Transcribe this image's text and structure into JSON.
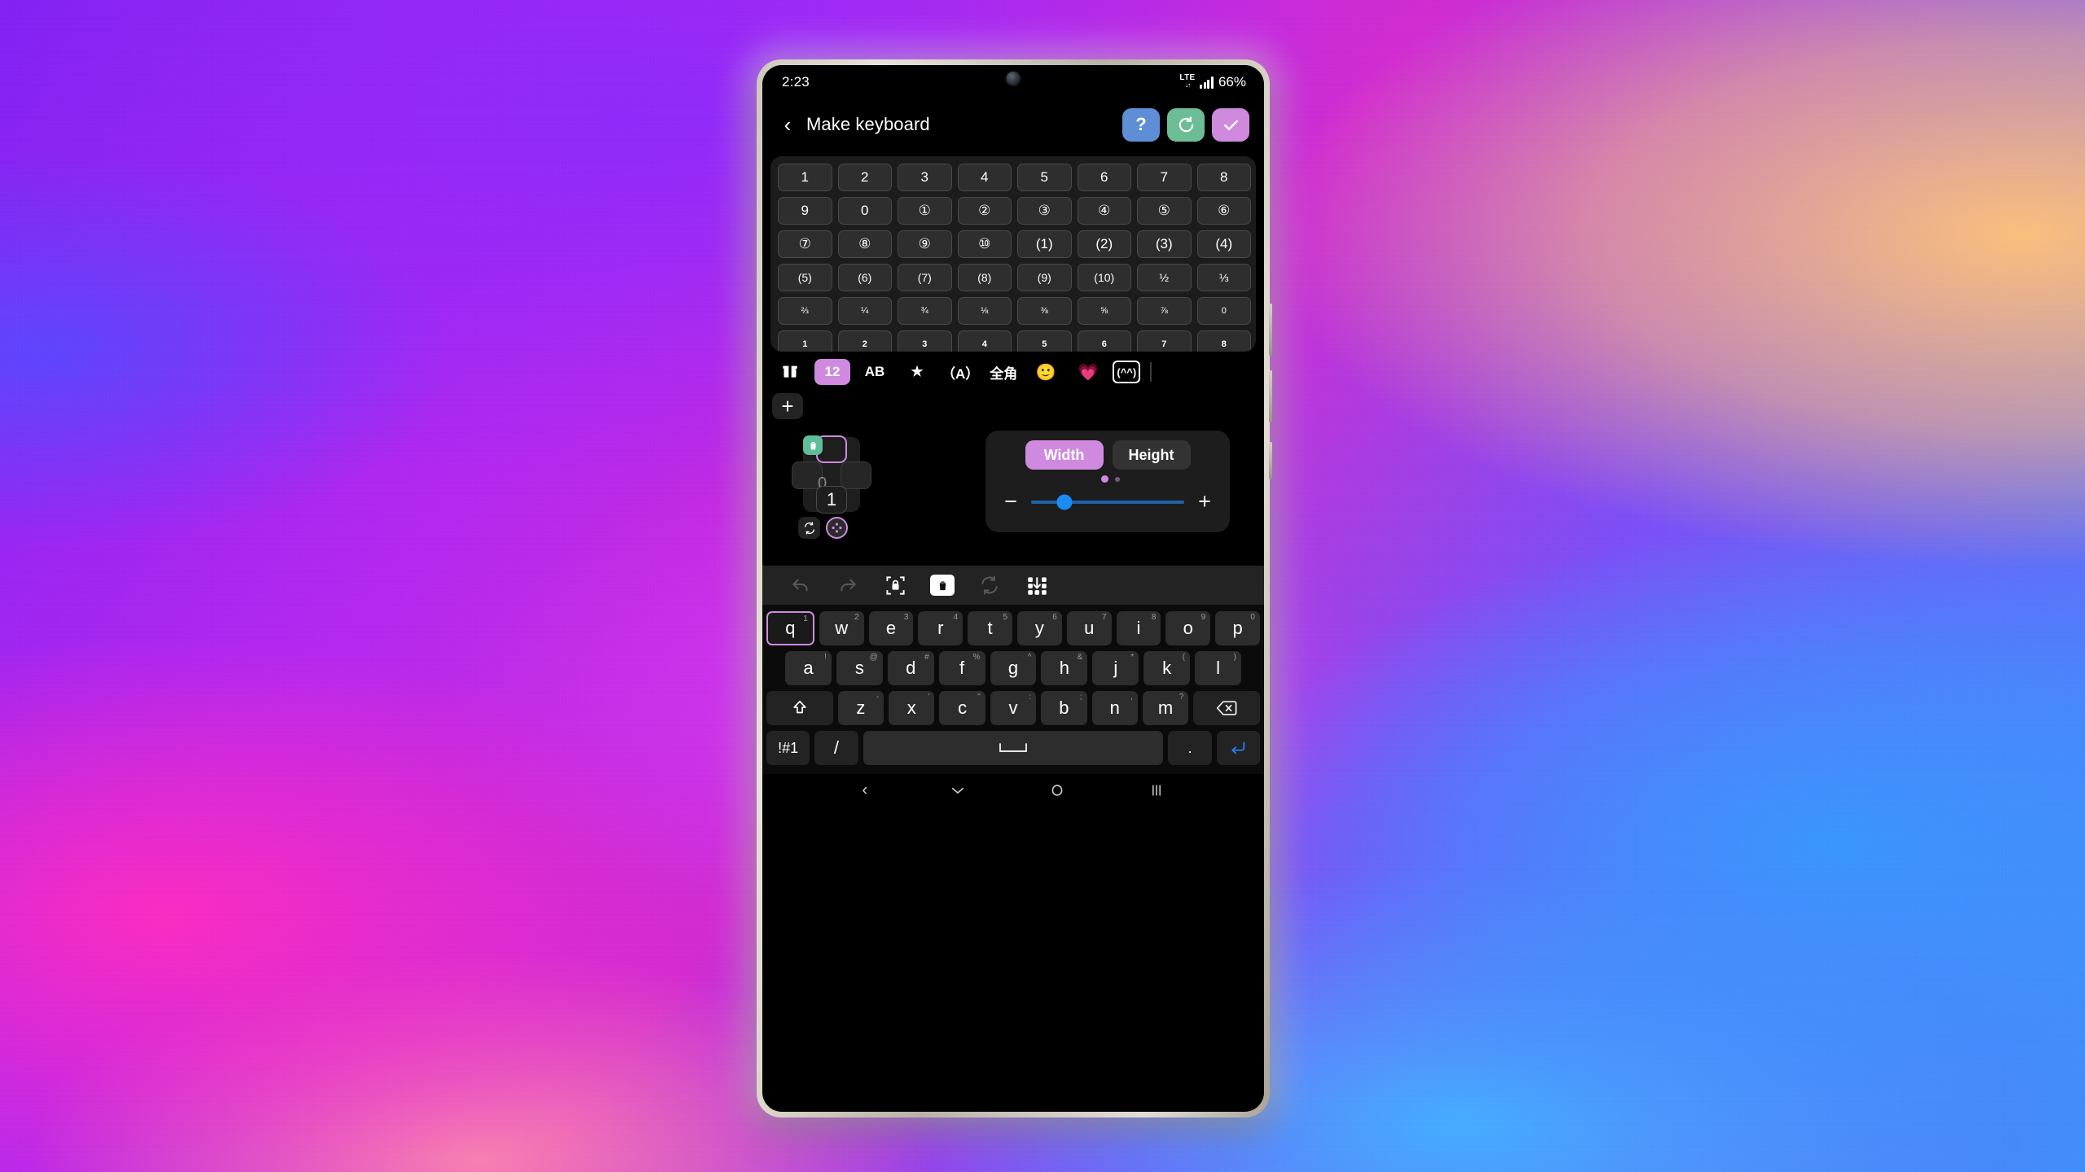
{
  "status_bar": {
    "time": "2:23",
    "network_type": "LTE",
    "network_arrows": "↓↑",
    "battery": "66%"
  },
  "app_bar": {
    "back_icon": "chevron-left-icon",
    "title": "Make keyboard",
    "actions": [
      {
        "name": "help-button",
        "label": "?",
        "color": "#5e8ed6"
      },
      {
        "name": "reset-button",
        "label": "↺",
        "color": "#6cbd96"
      },
      {
        "name": "confirm-button",
        "label": "✓",
        "color": "#cf8ae0"
      }
    ]
  },
  "palette": {
    "rows": [
      {
        "style": "normal",
        "keys": [
          "1",
          "2",
          "3",
          "4",
          "5",
          "6",
          "7",
          "8"
        ]
      },
      {
        "style": "normal",
        "keys": [
          "9",
          "0",
          "①",
          "②",
          "③",
          "④",
          "⑤",
          "⑥"
        ]
      },
      {
        "style": "normal",
        "keys": [
          "⑦",
          "⑧",
          "⑨",
          "⑩",
          "(1)",
          "(2)",
          "(3)",
          "(4)"
        ]
      },
      {
        "style": "small",
        "keys": [
          "(5)",
          "(6)",
          "(7)",
          "(8)",
          "(9)",
          "(10)",
          "½",
          "⅓"
        ]
      },
      {
        "style": "tiny",
        "keys": [
          "⅔",
          "¼",
          "¾",
          "⅛",
          "⅜",
          "⅝",
          "⅞",
          "0"
        ]
      },
      {
        "style": "sup",
        "keys": [
          "1",
          "2",
          "3",
          "4",
          "5",
          "6",
          "7",
          "8"
        ]
      }
    ]
  },
  "categories": [
    {
      "name": "category-symbols",
      "label": "⬚",
      "active": false,
      "kind": "glyph"
    },
    {
      "name": "category-numbers",
      "label": "12",
      "active": true,
      "kind": "text"
    },
    {
      "name": "category-ab",
      "label": "AB",
      "active": false,
      "kind": "text"
    },
    {
      "name": "category-star",
      "label": "★",
      "active": false,
      "kind": "glyph"
    },
    {
      "name": "category-paren-a",
      "label": "（A）",
      "active": false,
      "kind": "text"
    },
    {
      "name": "category-fullwidth",
      "label": "全角",
      "active": false,
      "kind": "text"
    },
    {
      "name": "category-emoji",
      "label": "🙂",
      "active": false,
      "kind": "emoji"
    },
    {
      "name": "category-heart",
      "label": "💗",
      "active": false,
      "kind": "emoji"
    },
    {
      "name": "category-kaomoji",
      "label": "(^^)",
      "active": false,
      "kind": "box"
    }
  ],
  "editor": {
    "add_key_label": "+",
    "flick": {
      "delete_icon": "trash-icon",
      "rotate_icon": "rotate-icon",
      "move_icon": "move-handle-icon",
      "center_label": "1",
      "ghost_label": "0",
      "selected_direction": "up"
    },
    "size_panel": {
      "tabs": [
        {
          "name": "width-tab",
          "label": "Width",
          "active": true
        },
        {
          "name": "height-tab",
          "label": "Height",
          "active": false
        }
      ],
      "page_dots": [
        true,
        false
      ],
      "minus_label": "−",
      "plus_label": "+",
      "slider_percent": 22
    }
  },
  "edit_toolbar": [
    {
      "name": "undo-button",
      "icon": "undo-icon",
      "enabled": false
    },
    {
      "name": "redo-button",
      "icon": "redo-icon",
      "enabled": false
    },
    {
      "name": "lock-button",
      "icon": "lock-frame-icon",
      "enabled": true
    },
    {
      "name": "delete-button",
      "icon": "trash-icon",
      "enabled": true
    },
    {
      "name": "refresh-button",
      "icon": "refresh-icon",
      "enabled": false
    },
    {
      "name": "arrange-button",
      "icon": "grid-arrange-icon",
      "enabled": true
    }
  ],
  "keyboard": {
    "row1": [
      {
        "key": "q",
        "sup": "1",
        "selected": true
      },
      {
        "key": "w",
        "sup": "2",
        "selected": false
      },
      {
        "key": "e",
        "sup": "3",
        "selected": false
      },
      {
        "key": "r",
        "sup": "4",
        "selected": false
      },
      {
        "key": "t",
        "sup": "5",
        "selected": false
      },
      {
        "key": "y",
        "sup": "6",
        "selected": false
      },
      {
        "key": "u",
        "sup": "7",
        "selected": false
      },
      {
        "key": "i",
        "sup": "8",
        "selected": false
      },
      {
        "key": "o",
        "sup": "9",
        "selected": false
      },
      {
        "key": "p",
        "sup": "0",
        "selected": false
      }
    ],
    "row2": [
      {
        "key": "a",
        "sup": "!"
      },
      {
        "key": "s",
        "sup": "@"
      },
      {
        "key": "d",
        "sup": "#"
      },
      {
        "key": "f",
        "sup": "%"
      },
      {
        "key": "g",
        "sup": "^"
      },
      {
        "key": "h",
        "sup": "&"
      },
      {
        "key": "j",
        "sup": "*"
      },
      {
        "key": "k",
        "sup": "("
      },
      {
        "key": "l",
        "sup": ")"
      }
    ],
    "row3": {
      "shift": "shift-icon",
      "keys": [
        {
          "key": "z",
          "sup": "-"
        },
        {
          "key": "x",
          "sup": "'"
        },
        {
          "key": "c",
          "sup": "\""
        },
        {
          "key": "v",
          "sup": ":"
        },
        {
          "key": "b",
          "sup": ";"
        },
        {
          "key": "n",
          "sup": ","
        },
        {
          "key": "m",
          "sup": "?"
        }
      ],
      "backspace": "backspace-icon"
    },
    "row4": {
      "symbols": "!#1",
      "slash": "/",
      "space": "space-icon",
      "period": ".",
      "enter": "enter-icon"
    }
  },
  "nav_bar": {
    "back": "‹",
    "hide_keyboard": "ˇ",
    "home": "○",
    "recents": "‖∣"
  }
}
